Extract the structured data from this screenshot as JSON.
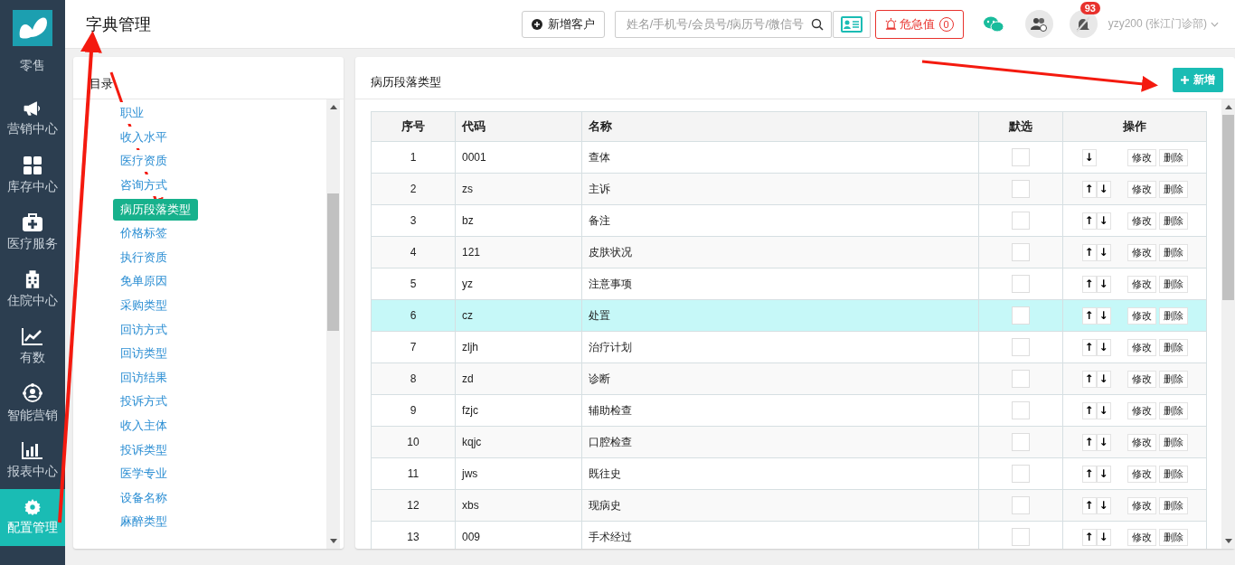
{
  "sidebar": {
    "items": [
      {
        "label": "零售",
        "selected": false
      },
      {
        "label": "营销中心",
        "selected": false
      },
      {
        "label": "库存中心",
        "selected": false
      },
      {
        "label": "医疗服务",
        "selected": false
      },
      {
        "label": "住院中心",
        "selected": false
      },
      {
        "label": "有数",
        "selected": false
      },
      {
        "label": "智能营销",
        "selected": false
      },
      {
        "label": "报表中心",
        "selected": false
      },
      {
        "label": "配置管理",
        "selected": true
      }
    ]
  },
  "header": {
    "title": "字典管理",
    "add_customer": "新增客户",
    "search": {
      "placeholder": "姓名/手机号/会员号/病历号/微信号"
    },
    "alert": {
      "label": "危急值",
      "count": "0"
    },
    "notifications": "93",
    "user": "yzy200 (张江门诊部)"
  },
  "directory": {
    "title": "目录",
    "items": [
      {
        "label": "职业",
        "selected": false
      },
      {
        "label": "收入水平",
        "selected": false
      },
      {
        "label": "医疗资质",
        "selected": false
      },
      {
        "label": "咨询方式",
        "selected": false
      },
      {
        "label": "病历段落类型",
        "selected": true
      },
      {
        "label": "价格标签",
        "selected": false
      },
      {
        "label": "执行资质",
        "selected": false
      },
      {
        "label": "免单原因",
        "selected": false
      },
      {
        "label": "采购类型",
        "selected": false
      },
      {
        "label": "回访方式",
        "selected": false
      },
      {
        "label": "回访类型",
        "selected": false
      },
      {
        "label": "回访结果",
        "selected": false
      },
      {
        "label": "投诉方式",
        "selected": false
      },
      {
        "label": "收入主体",
        "selected": false
      },
      {
        "label": "投诉类型",
        "selected": false
      },
      {
        "label": "医学专业",
        "selected": false
      },
      {
        "label": "设备名称",
        "selected": false
      },
      {
        "label": "麻醉类型",
        "selected": false
      }
    ]
  },
  "panel": {
    "title": "病历段落类型",
    "add_button": "新增"
  },
  "table": {
    "columns": [
      "序号",
      "代码",
      "名称",
      "默选",
      "操作"
    ],
    "rows": [
      {
        "no": "1",
        "code": "0001",
        "name": "查体",
        "checked": false,
        "selected": false,
        "arrows": [
          "↓"
        ],
        "edit": "修改",
        "delete": "删除"
      },
      {
        "no": "2",
        "code": "zs",
        "name": "主诉",
        "checked": false,
        "selected": false,
        "arrows": [
          "↑",
          "↓"
        ],
        "edit": "修改",
        "delete": "删除"
      },
      {
        "no": "3",
        "code": "bz",
        "name": "备注",
        "checked": false,
        "selected": false,
        "arrows": [
          "↑",
          "↓"
        ],
        "edit": "修改",
        "delete": "删除"
      },
      {
        "no": "4",
        "code": "121",
        "name": "皮肤状况",
        "checked": false,
        "selected": false,
        "arrows": [
          "↑",
          "↓"
        ],
        "edit": "修改",
        "delete": "删除"
      },
      {
        "no": "5",
        "code": "yz",
        "name": "注意事项",
        "checked": false,
        "selected": false,
        "arrows": [
          "↑",
          "↓"
        ],
        "edit": "修改",
        "delete": "删除"
      },
      {
        "no": "6",
        "code": "cz",
        "name": "处置",
        "checked": false,
        "selected": true,
        "arrows": [
          "↑",
          "↓"
        ],
        "edit": "修改",
        "delete": "删除"
      },
      {
        "no": "7",
        "code": "zljh",
        "name": "治疗计划",
        "checked": false,
        "selected": false,
        "arrows": [
          "↑",
          "↓"
        ],
        "edit": "修改",
        "delete": "删除"
      },
      {
        "no": "8",
        "code": "zd",
        "name": "诊断",
        "checked": false,
        "selected": false,
        "arrows": [
          "↑",
          "↓"
        ],
        "edit": "修改",
        "delete": "删除"
      },
      {
        "no": "9",
        "code": "fzjc",
        "name": "辅助检查",
        "checked": false,
        "selected": false,
        "arrows": [
          "↑",
          "↓"
        ],
        "edit": "修改",
        "delete": "删除"
      },
      {
        "no": "10",
        "code": "kqjc",
        "name": "口腔检查",
        "checked": false,
        "selected": false,
        "arrows": [
          "↑",
          "↓"
        ],
        "edit": "修改",
        "delete": "删除"
      },
      {
        "no": "11",
        "code": "jws",
        "name": "既往史",
        "checked": false,
        "selected": false,
        "arrows": [
          "↑",
          "↓"
        ],
        "edit": "修改",
        "delete": "删除"
      },
      {
        "no": "12",
        "code": "xbs",
        "name": "现病史",
        "checked": false,
        "selected": false,
        "arrows": [
          "↑",
          "↓"
        ],
        "edit": "修改",
        "delete": "删除"
      },
      {
        "no": "13",
        "code": "009",
        "name": "手术经过",
        "checked": false,
        "selected": false,
        "arrows": [
          "↑",
          "↓"
        ],
        "edit": "修改",
        "delete": "删除"
      }
    ]
  }
}
